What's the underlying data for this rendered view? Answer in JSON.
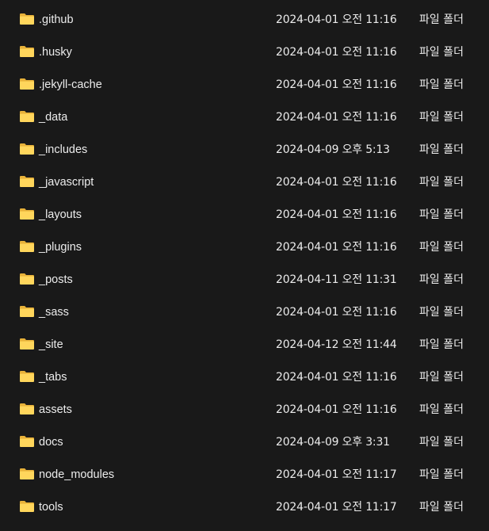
{
  "files": [
    {
      "name": ".github",
      "modified": "2024-04-01 오전 11:16",
      "type": "파일 폴더",
      "icon": "folder-icon"
    },
    {
      "name": ".husky",
      "modified": "2024-04-01 오전 11:16",
      "type": "파일 폴더",
      "icon": "folder-icon"
    },
    {
      "name": ".jekyll-cache",
      "modified": "2024-04-01 오전 11:16",
      "type": "파일 폴더",
      "icon": "folder-icon"
    },
    {
      "name": "_data",
      "modified": "2024-04-01 오전 11:16",
      "type": "파일 폴더",
      "icon": "folder-icon"
    },
    {
      "name": "_includes",
      "modified": "2024-04-09 오후 5:13",
      "type": "파일 폴더",
      "icon": "folder-icon"
    },
    {
      "name": "_javascript",
      "modified": "2024-04-01 오전 11:16",
      "type": "파일 폴더",
      "icon": "folder-icon"
    },
    {
      "name": "_layouts",
      "modified": "2024-04-01 오전 11:16",
      "type": "파일 폴더",
      "icon": "folder-icon"
    },
    {
      "name": "_plugins",
      "modified": "2024-04-01 오전 11:16",
      "type": "파일 폴더",
      "icon": "folder-icon"
    },
    {
      "name": "_posts",
      "modified": "2024-04-11 오전 11:31",
      "type": "파일 폴더",
      "icon": "folder-icon"
    },
    {
      "name": "_sass",
      "modified": "2024-04-01 오전 11:16",
      "type": "파일 폴더",
      "icon": "folder-icon"
    },
    {
      "name": "_site",
      "modified": "2024-04-12 오전 11:44",
      "type": "파일 폴더",
      "icon": "folder-icon"
    },
    {
      "name": "_tabs",
      "modified": "2024-04-01 오전 11:16",
      "type": "파일 폴더",
      "icon": "folder-icon"
    },
    {
      "name": "assets",
      "modified": "2024-04-01 오전 11:16",
      "type": "파일 폴더",
      "icon": "folder-icon"
    },
    {
      "name": "docs",
      "modified": "2024-04-09 오후 3:31",
      "type": "파일 폴더",
      "icon": "folder-icon"
    },
    {
      "name": "node_modules",
      "modified": "2024-04-01 오전 11:17",
      "type": "파일 폴더",
      "icon": "folder-icon"
    },
    {
      "name": "tools",
      "modified": "2024-04-01 오전 11:17",
      "type": "파일 폴더",
      "icon": "folder-icon"
    }
  ],
  "colors": {
    "background": "#191919",
    "text": "#ececec",
    "folder_back": "#e8b23a",
    "folder_front": "#ffd65c"
  }
}
